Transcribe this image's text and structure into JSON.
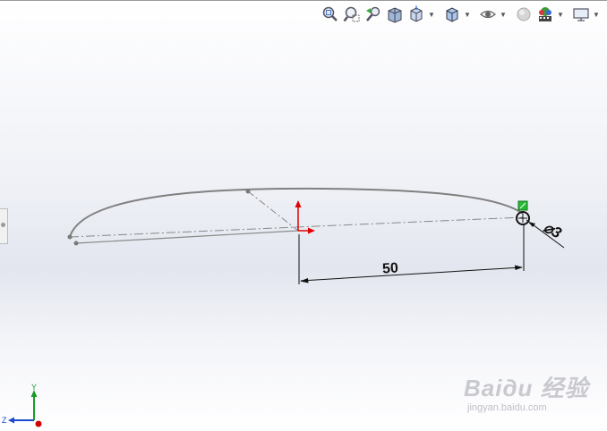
{
  "toolbar": {
    "icons": [
      "zoom-to-fit-icon",
      "zoom-area-icon",
      "previous-view-icon",
      "section-view-icon",
      "view-orientation-icon",
      "display-style-icon",
      "hide-show-icon",
      "edit-appearance-icon",
      "apply-scene-icon",
      "view-settings-icon"
    ]
  },
  "sketch": {
    "dimension_length": "50",
    "dimension_diameter": "⌀3"
  },
  "triad": {
    "y_label": "Y",
    "z_label": "Z"
  },
  "watermark": {
    "brand": "Baiдu 经验",
    "url": "jingyan.baidu.com"
  },
  "colors": {
    "sketch_line": "#808080",
    "origin_red": "#e00000",
    "point_green": "#22bb33",
    "dimension_black": "#111111"
  }
}
